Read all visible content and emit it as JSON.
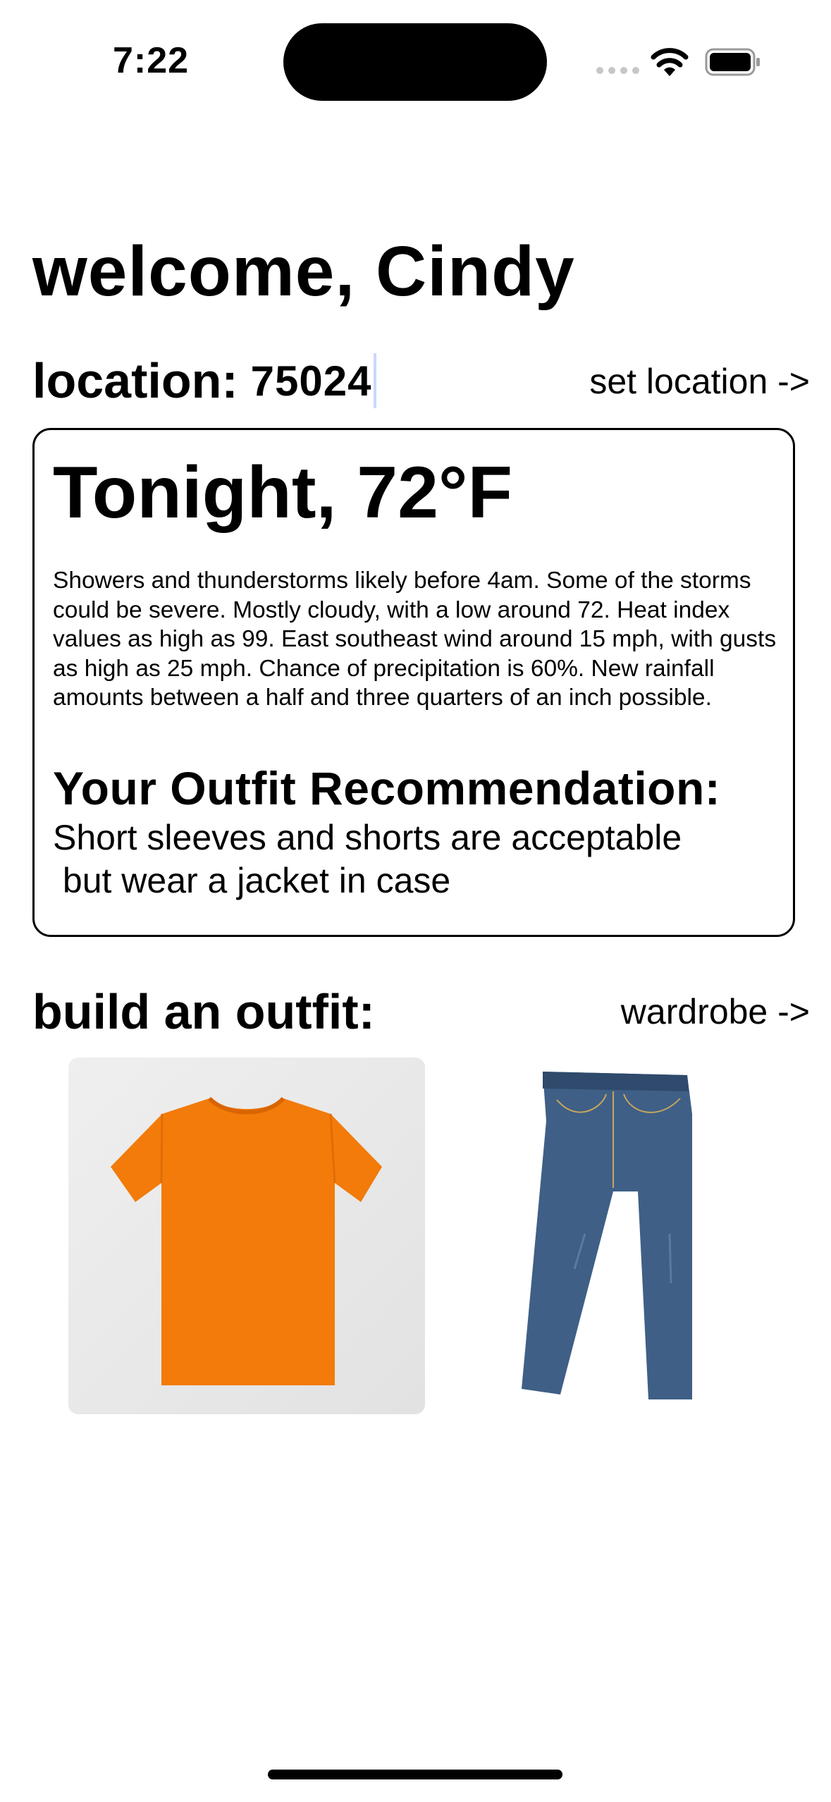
{
  "status_bar": {
    "time": "7:22"
  },
  "header": {
    "welcome": "welcome, Cindy",
    "location_label": "location:",
    "location_value": "75024",
    "set_location_link": "set location ->"
  },
  "weather": {
    "title": "Tonight, 72°F",
    "description": "Showers and thunderstorms likely before 4am. Some of the storms could be severe. Mostly cloudy, with a low around 72. Heat index values as high as 99. East southeast wind around 15 mph, with gusts as high as 25 mph. Chance of precipitation is 60%. New rainfall amounts between a half and three quarters of an inch possible.",
    "recommendation_title": "Your Outfit Recommendation:",
    "recommendation_text": "Short sleeves and shorts are acceptable\n but wear a jacket in case"
  },
  "outfit": {
    "title": "build an outfit:",
    "wardrobe_link": "wardrobe ->",
    "items": [
      {
        "icon": "orange-tshirt-image",
        "color": "#f27b0a"
      },
      {
        "icon": "blue-jeans-image",
        "color": "#3f5f86"
      }
    ]
  }
}
